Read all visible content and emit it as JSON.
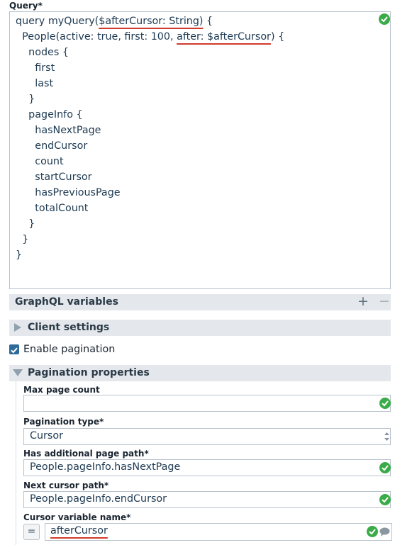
{
  "query": {
    "label": "Query*",
    "lines": [
      "query myQuery(",
      "$afterCursor: String)",
      " {",
      "  People(active: true, first: 100, ",
      "after: $afterCursor",
      ") {",
      "    nodes {",
      "      first",
      "      last",
      "    }",
      "    pageInfo {",
      "      hasNextPage",
      "      endCursor",
      "      count",
      "      startCursor",
      "      hasPreviousPage",
      "      totalCount",
      "    }",
      "  }",
      "}"
    ]
  },
  "graphql_variables": {
    "title": "GraphQL variables",
    "add_icon": "plus-icon",
    "remove_icon": "minus-icon"
  },
  "client_settings": {
    "title": "Client settings"
  },
  "enable_pagination": {
    "label": "Enable pagination",
    "checked": true
  },
  "pagination_properties": {
    "title": "Pagination properties",
    "max_page_count": {
      "label": "Max page count",
      "value": ""
    },
    "pagination_type": {
      "label": "Pagination type*",
      "value": "Cursor"
    },
    "has_additional_page_path": {
      "label": "Has additional page path*",
      "value": "People.pageInfo.hasNextPage"
    },
    "next_cursor_path": {
      "label": "Next cursor path*",
      "value": "People.pageInfo.endCursor"
    },
    "cursor_variable_name": {
      "label": "Cursor variable name*",
      "value": "afterCursor",
      "expr_toggle": "="
    }
  },
  "colors": {
    "valid": "#3bab4a",
    "accent_underline": "#d13a2c",
    "bar": "#e4e8ec"
  }
}
